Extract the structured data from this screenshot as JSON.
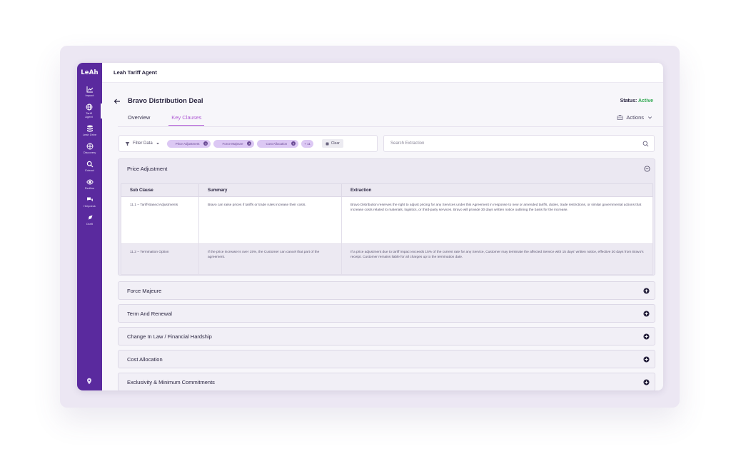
{
  "app": {
    "logo": "LeAh",
    "window_title": "Leah Tariff Agent"
  },
  "sidebar": {
    "items": [
      {
        "label": "Impact",
        "icon": "chart-line-icon"
      },
      {
        "label": "Tariff\nAgent",
        "icon": "globe-icon",
        "active": true
      },
      {
        "label": "Leah Drive",
        "icon": "database-icon"
      },
      {
        "label": "Discovery",
        "icon": "globe-grid-icon"
      },
      {
        "label": "Extract",
        "icon": "search-icon"
      },
      {
        "label": "Redline",
        "icon": "eye-icon"
      },
      {
        "label": "Helpdesk",
        "icon": "chat-icon"
      },
      {
        "label": "Draft",
        "icon": "pen-nib-icon"
      }
    ],
    "bottom_icon": "location-pin-icon"
  },
  "header": {
    "deal_title": "Bravo Distribution Deal",
    "status_label": "Status:",
    "status_value": "Active",
    "status_color": "#2fa84f",
    "tabs": [
      {
        "label": "Overview",
        "active": false
      },
      {
        "label": "Key Clauses",
        "active": true
      }
    ],
    "actions_label": "Actions"
  },
  "filters": {
    "label": "Filter Data",
    "chips": [
      "Price Adjustment",
      "Force Majeure",
      "Cost Allocation"
    ],
    "more_chip": "+ 11",
    "clear_label": "Clear",
    "search_placeholder": "Search Extraction"
  },
  "expanded_clause": {
    "title": "Price Adjustment",
    "columns": [
      "Sub Clause",
      "Summary",
      "Extraction"
    ],
    "rows": [
      {
        "sub_clause": "11.1 – Tariff-Based Adjustments",
        "summary": "Bravo can raise prices if tariffs or trade rules increase their costs.",
        "extraction": "Bravo Distribution reserves the right to adjust pricing for any Services under this Agreement in response to new or amended tariffs, duties, trade restrictions, or similar governmental actions that increase costs related to materials, logistics, or third-party services. Bravo will provide 30 days written notice outlining the basis for the increase."
      },
      {
        "sub_clause": "11.2 – Termination Option",
        "summary": "If the price increase is over 15%, the Customer can cancel that part of the agreement.",
        "extraction": "If a price adjustment due to tariff impact exceeds 15% of the current rate for any Service, Customer may terminate the affected Service with 15 days' written notice, effective 30 days from Bravo's receipt. Customer remains liable for all charges up to the termination date."
      }
    ]
  },
  "collapsed_clauses": [
    "Force Majeure",
    "Term And Renewal",
    "Change In Law / Financial Hardship",
    "Cost Allocation",
    "Exclusivity & Minimum Commitments"
  ],
  "colors": {
    "sidebar": "#5a2a9e",
    "accent": "#b15fd6",
    "chip": "#dcc8f4"
  }
}
